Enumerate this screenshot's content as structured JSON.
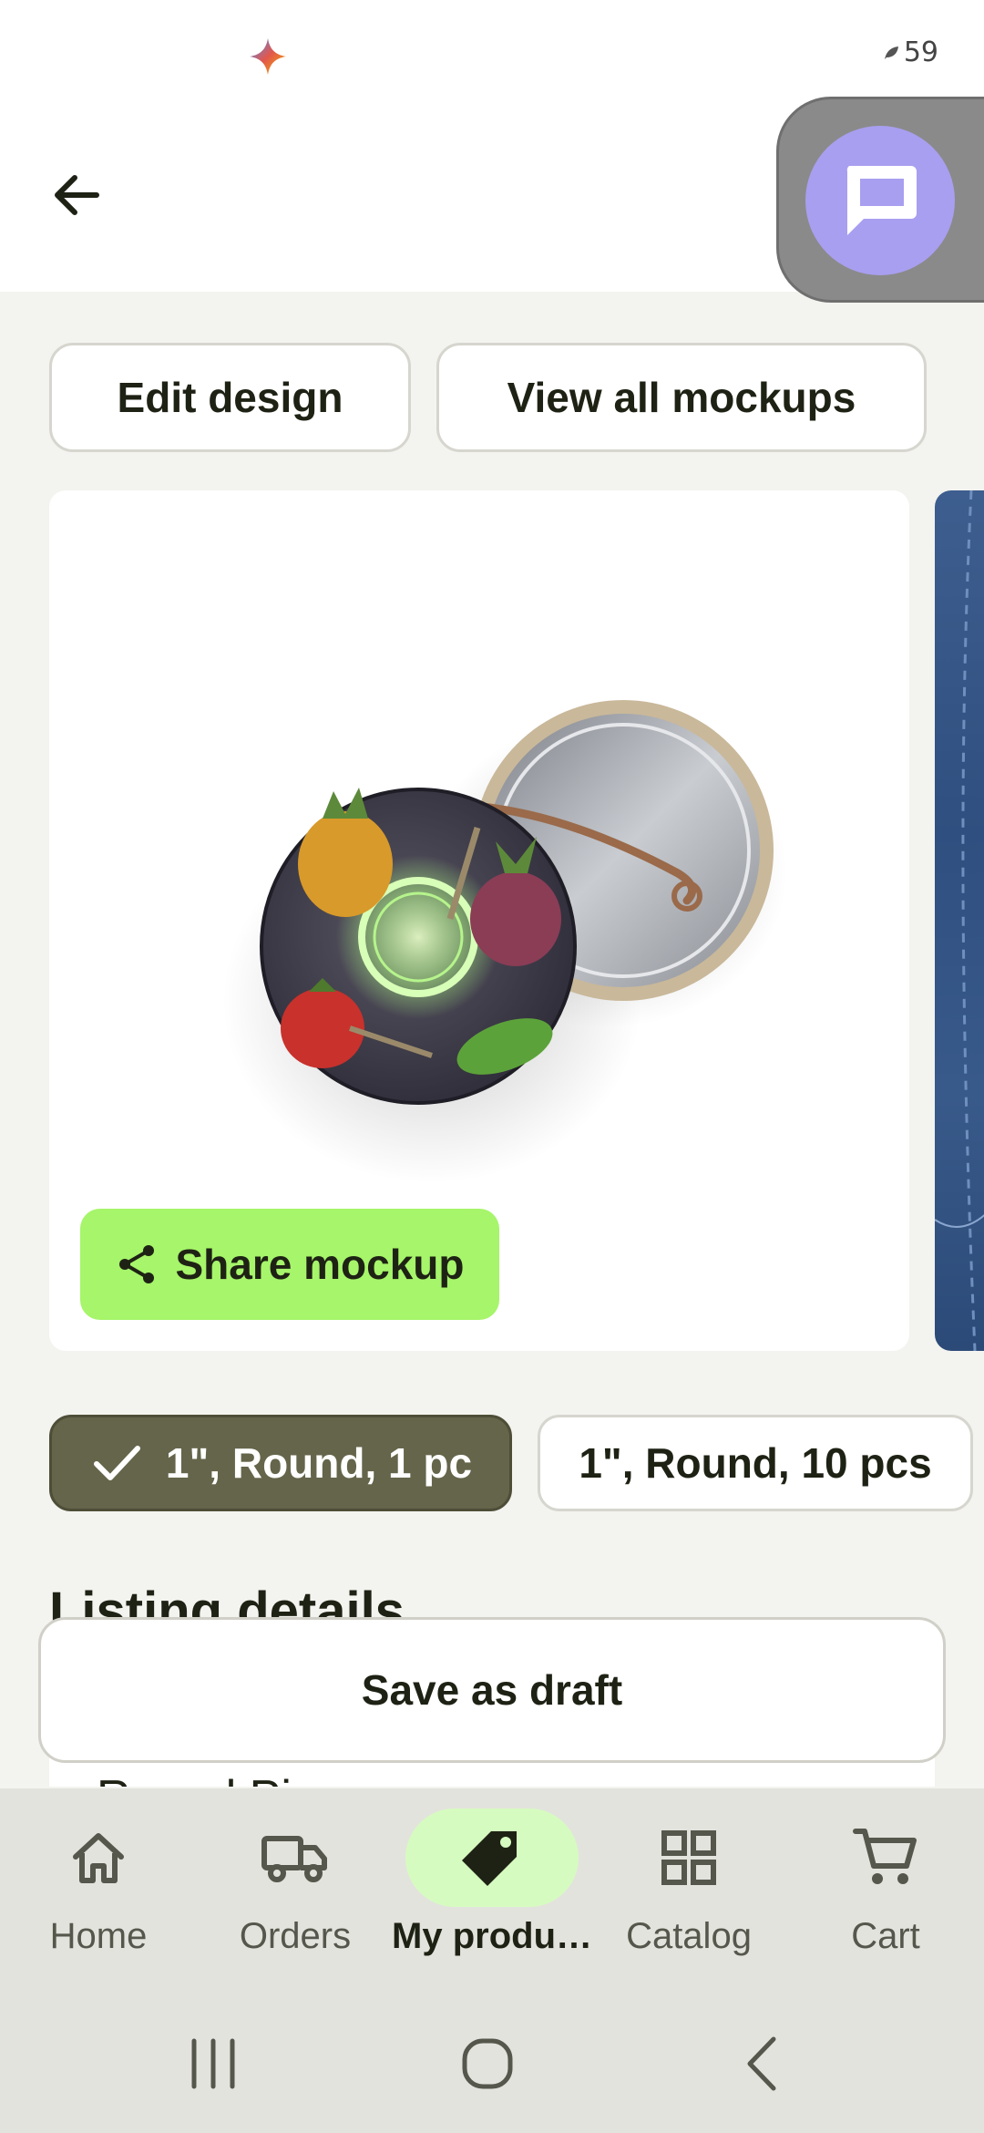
{
  "status_bar": {
    "battery": "59",
    "icons": [
      "sparkle-icon",
      "leaf-icon"
    ]
  },
  "header": {
    "back_icon": "arrow-left-icon",
    "chat_icon": "chat-bubble-icon"
  },
  "actions": {
    "edit_design": "Edit design",
    "view_all_mockups": "View all mockups"
  },
  "mockup": {
    "share_label": "Share mockup",
    "share_icon": "share-icon"
  },
  "variants": {
    "selected": "1\", Round, 1 pc",
    "other": "1\", Round, 10 pcs"
  },
  "listing": {
    "heading": "Listing details",
    "first_value": "Round Pin"
  },
  "save_draft": "Save as draft",
  "bottom_nav": {
    "items": [
      {
        "label": "Home",
        "icon": "home-icon"
      },
      {
        "label": "Orders",
        "icon": "truck-icon"
      },
      {
        "label": "My produ…",
        "icon": "tag-icon",
        "active": true
      },
      {
        "label": "Catalog",
        "icon": "grid-icon"
      },
      {
        "label": "Cart",
        "icon": "cart-icon"
      }
    ]
  },
  "colors": {
    "primary_green": "#a6f56a",
    "selected_chip": "#65654b",
    "chat_fab": "#a89ff0",
    "nav_active": "#d6fbc0"
  }
}
